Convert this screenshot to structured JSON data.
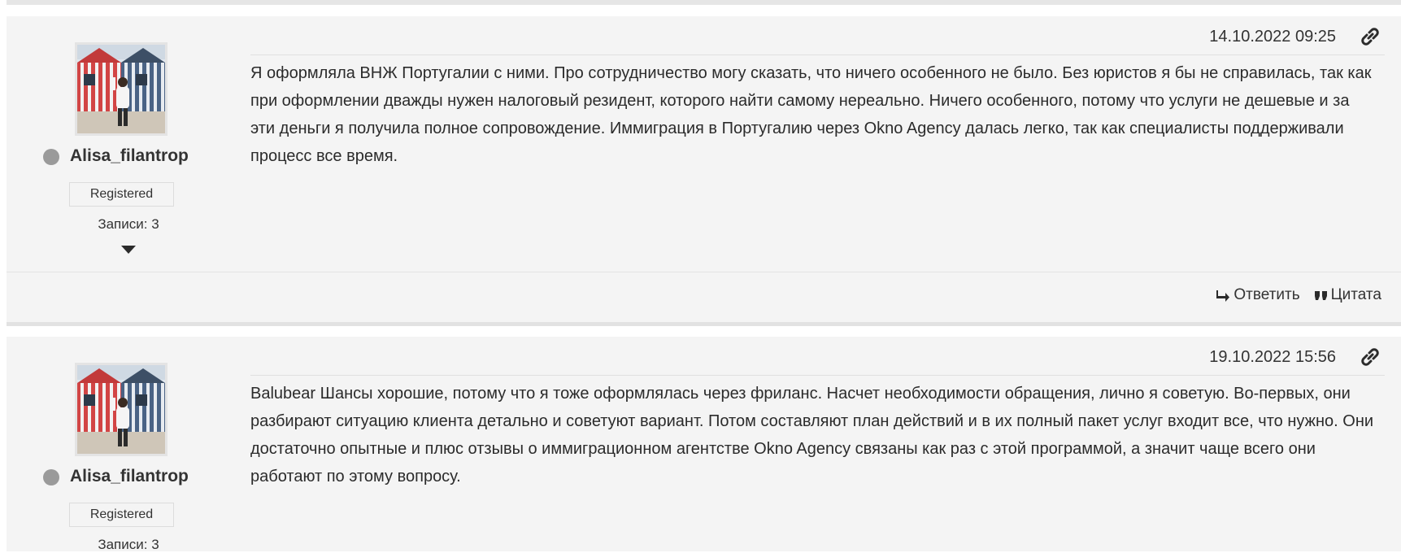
{
  "posts": [
    {
      "author": {
        "username": "Alisa_filantrop",
        "role": "Registered",
        "posts_count": "Записи: 3"
      },
      "date": "14.10.2022 09:25",
      "content": "Я оформляла ВНЖ Португалии с ними. Про сотрудничество могу сказать, что ничего особенного не было. Без юристов я бы не справилась, так как при оформлении дважды нужен налоговый резидент, которого найти самому нереально. Ничего особенного, потому что услуги не дешевые и за эти деньги я получила полное сопровождение. Иммиграция в Португалию через Okno Agency далась легко, так как специалисты поддерживали процесс все время.",
      "actions": {
        "reply": "Ответить",
        "quote": "Цитата"
      }
    },
    {
      "author": {
        "username": "Alisa_filantrop",
        "role": "Registered",
        "posts_count": "Записи: 3"
      },
      "date": "19.10.2022 15:56",
      "content": "Balubear Шансы хорошие, потому что я тоже оформлялась через фриланс. Насчет необходимости обращения, лично я советую. Во-первых, они разбирают ситуацию клиента детально и советуют вариант. Потом составляют план действий и в их полный пакет услуг входит все, что нужно. Они достаточно опытные и плюс отзывы о иммиграционном агентстве Okno Agency связаны как раз с этой программой, а значит чаще всего они работают по этому вопросу."
    }
  ],
  "icons": {
    "link": "link-icon",
    "reply": "reply-arrow-icon",
    "quote": "quote-icon",
    "expand": "caret-down-icon",
    "status": "status-dot"
  },
  "colors": {
    "background": "#f4f4f4",
    "status_offline": "#9a9a9a",
    "text": "#2b2b2b"
  }
}
